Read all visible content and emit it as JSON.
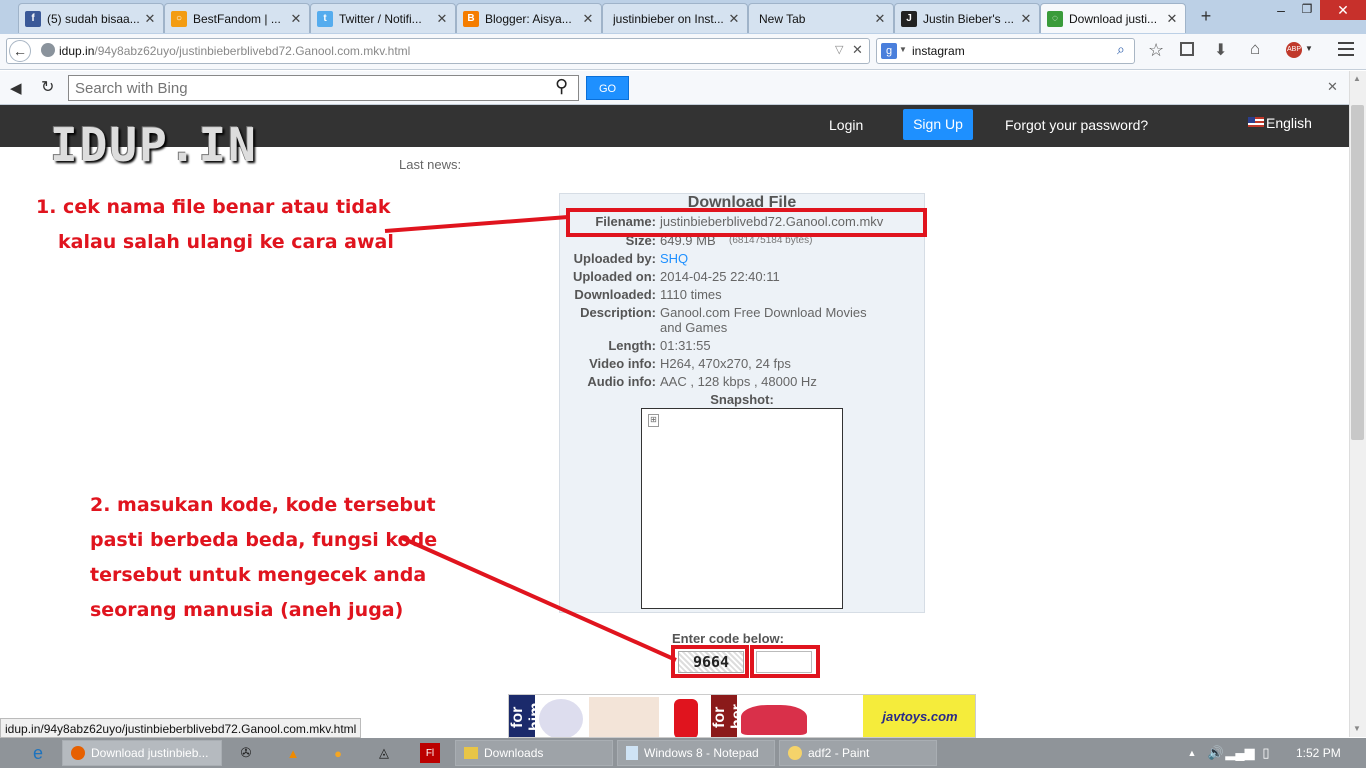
{
  "browser": {
    "tabs": [
      {
        "label": "(5) sudah bisaa...",
        "icon": "facebook-icon",
        "color": "#3b5998",
        "glyph": "f"
      },
      {
        "label": "BestFandom | ...",
        "icon": "blogger-circle-icon",
        "color": "#f39c12",
        "glyph": "○"
      },
      {
        "label": "Twitter / Notifi...",
        "icon": "twitter-icon",
        "color": "#55acee",
        "glyph": "t"
      },
      {
        "label": "Blogger: Aisya...",
        "icon": "blogger-icon",
        "color": "#f57d00",
        "glyph": "B"
      },
      {
        "label": "justinbieber on Inst...",
        "icon": "",
        "color": "",
        "glyph": ""
      },
      {
        "label": "New Tab",
        "icon": "",
        "color": "",
        "glyph": ""
      },
      {
        "label": "Justin Bieber's ...",
        "icon": "site-icon",
        "color": "#222",
        "glyph": "J"
      },
      {
        "label": "Download justi...",
        "icon": "loading-icon",
        "color": "#3a9b3a",
        "glyph": "◌"
      }
    ],
    "url": "idup.in/94y8abz62uyo/justinbieberblivebd72.Ganool.com.mkv.html",
    "url_domain": "idup.in",
    "url_path": "/94y8abz62uyo/justinbieberblivebd72.Ganool.com.mkv.html",
    "search_value": "instagram",
    "bing_placeholder": "Search with Bing",
    "bing_go": "GO"
  },
  "site": {
    "logo": "IDUP.IN",
    "nav": {
      "login": "Login",
      "signup": "Sign Up",
      "forgot": "Forgot your password?",
      "language": "English"
    },
    "last_news": "Last news:",
    "heading": "Download File",
    "fields": [
      {
        "label": "Filename:",
        "value": "justinbieberblivebd72.Ganool.com.mkv"
      },
      {
        "label": "Size:",
        "value": "649.9 MB",
        "extra": "(681475184 bytes)"
      },
      {
        "label": "Uploaded by:",
        "value": "SHQ"
      },
      {
        "label": "Uploaded on:",
        "value": "2014-04-25 22:40:11"
      },
      {
        "label": "Downloaded:",
        "value": "1110 times"
      },
      {
        "label": "Description:",
        "value": "Ganool.com Free Download Movies",
        "value2": "and Games"
      },
      {
        "label": "Length:",
        "value": "01:31:55"
      },
      {
        "label": "Video info:",
        "value": "H264, 470x270, 24 fps"
      },
      {
        "label": "Audio info:",
        "value": "AAC , 128 kbps , 48000 Hz"
      }
    ],
    "snapshot_label": "Snapshot:",
    "captcha_label": "Enter code below:",
    "captcha_code": "9664",
    "ad": {
      "text1": "for him",
      "text2": "for her",
      "brand": "javtoys.com"
    }
  },
  "annotations": {
    "note1_line1": "1. cek nama file benar atau tidak",
    "note1_line2": "kalau salah ulangi ke cara awal",
    "note2_line1": "2. masukan kode, kode tersebut",
    "note2_line2": "pasti berbeda beda, fungsi kode",
    "note2_line3": "tersebut untuk mengecek anda",
    "note2_line4": "seorang manusia (aneh juga)"
  },
  "status_url": "idup.in/94y8abz62uyo/justinbieberblivebd72.Ganool.com.mkv.html",
  "taskbar": {
    "items": [
      "Download justinbieb...",
      "Downloads",
      "Windows 8 - Notepad",
      "adf2 - Paint"
    ],
    "clock": "1:52 PM"
  },
  "colors": {
    "accent": "#1e90ff",
    "annotation": "#e0141e",
    "header": "#333333"
  }
}
